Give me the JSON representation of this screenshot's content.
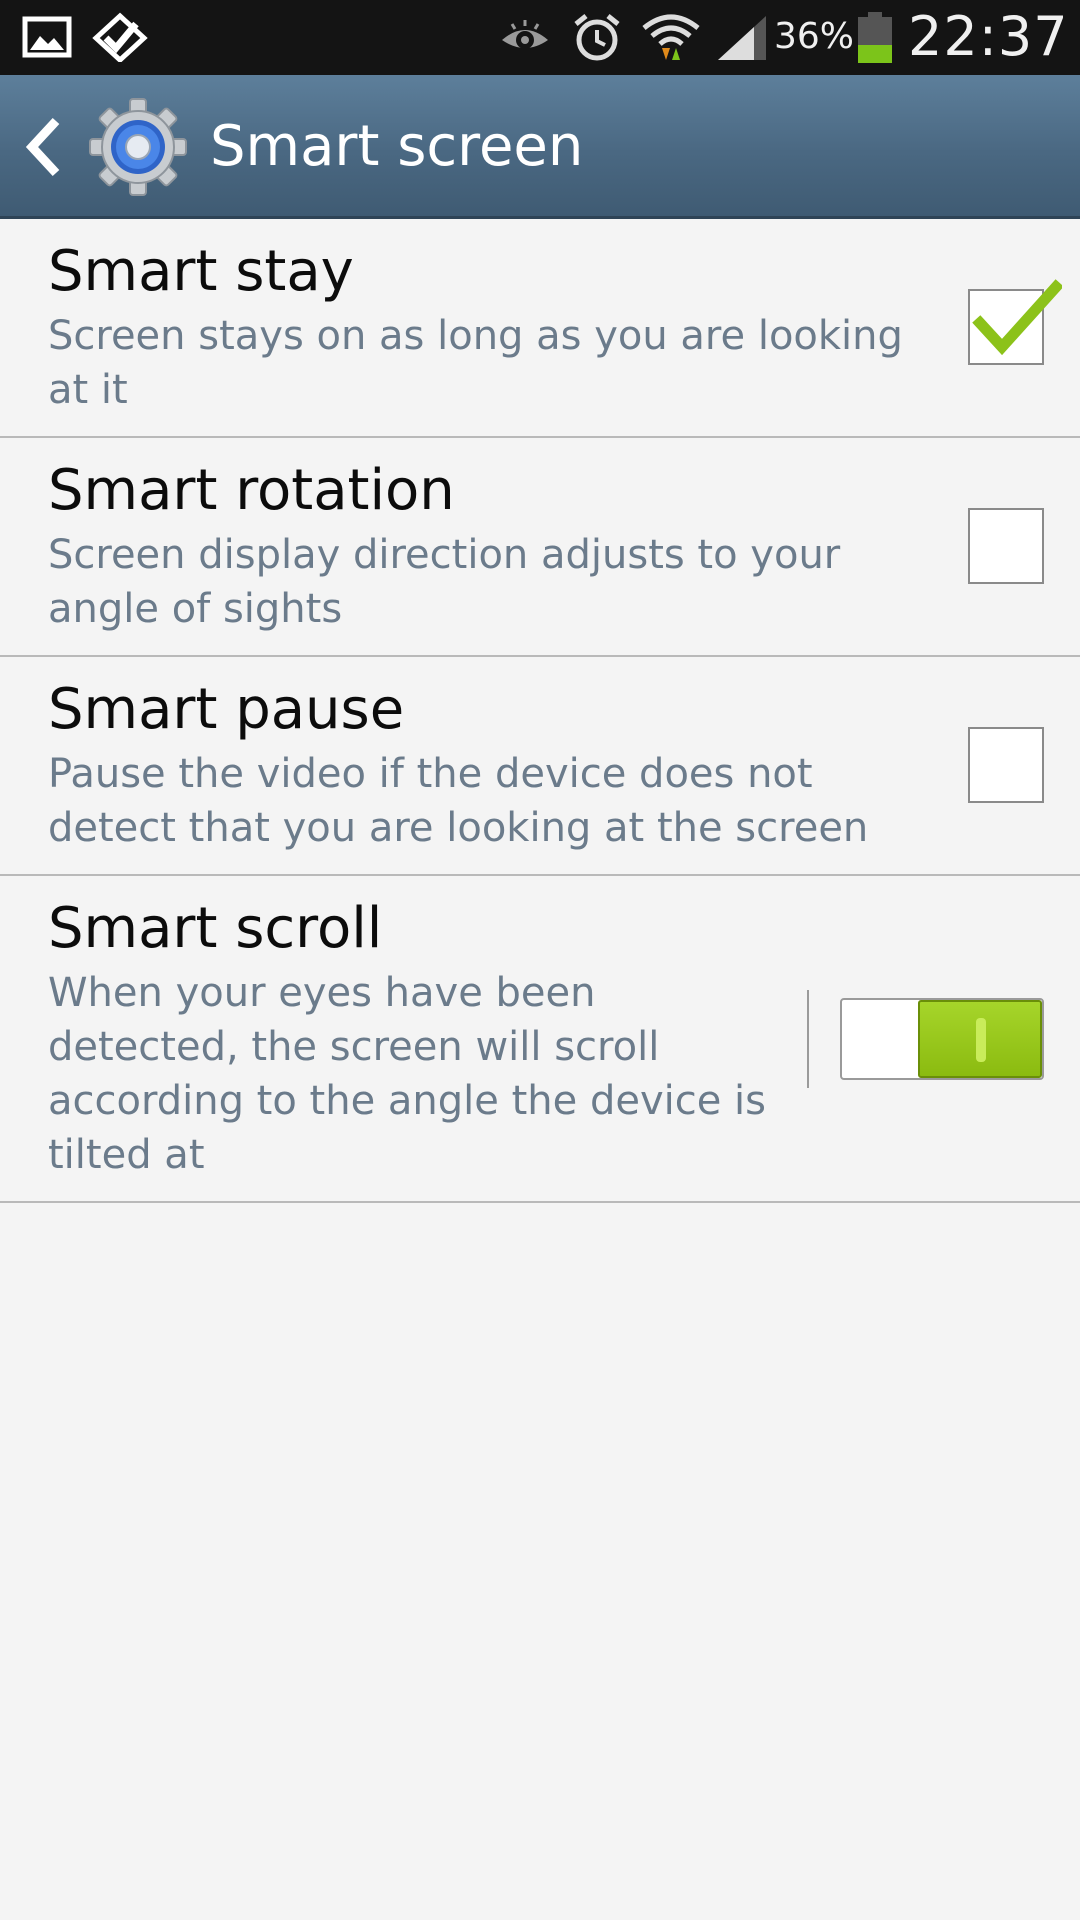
{
  "status_bar": {
    "battery_percent": "36%",
    "time": "22:37",
    "icons": [
      "gallery-icon",
      "task-check-icon",
      "smart-stay-eye-icon",
      "alarm-icon",
      "wifi-icon",
      "signal-icon",
      "battery-icon"
    ]
  },
  "header": {
    "title": "Smart screen",
    "icons": [
      "back-icon",
      "settings-gear-icon"
    ]
  },
  "colors": {
    "action_bar": "#4a6882",
    "accent_green": "#8bbb10",
    "summary_text": "#6b7b8b"
  },
  "settings": [
    {
      "title": "Smart stay",
      "summary": "Screen stays on as long as you are looking at it",
      "control": "checkbox",
      "checked": true
    },
    {
      "title": "Smart rotation",
      "summary": "Screen display direction adjusts to your angle of sights",
      "control": "checkbox",
      "checked": false
    },
    {
      "title": "Smart pause",
      "summary": "Pause the video if the device does not detect that you are looking at the screen",
      "control": "checkbox",
      "checked": false
    },
    {
      "title": "Smart scroll",
      "summary": "When your eyes have been detected, the screen will scroll according to the angle the device is tilted at",
      "control": "switch",
      "on": true
    }
  ]
}
